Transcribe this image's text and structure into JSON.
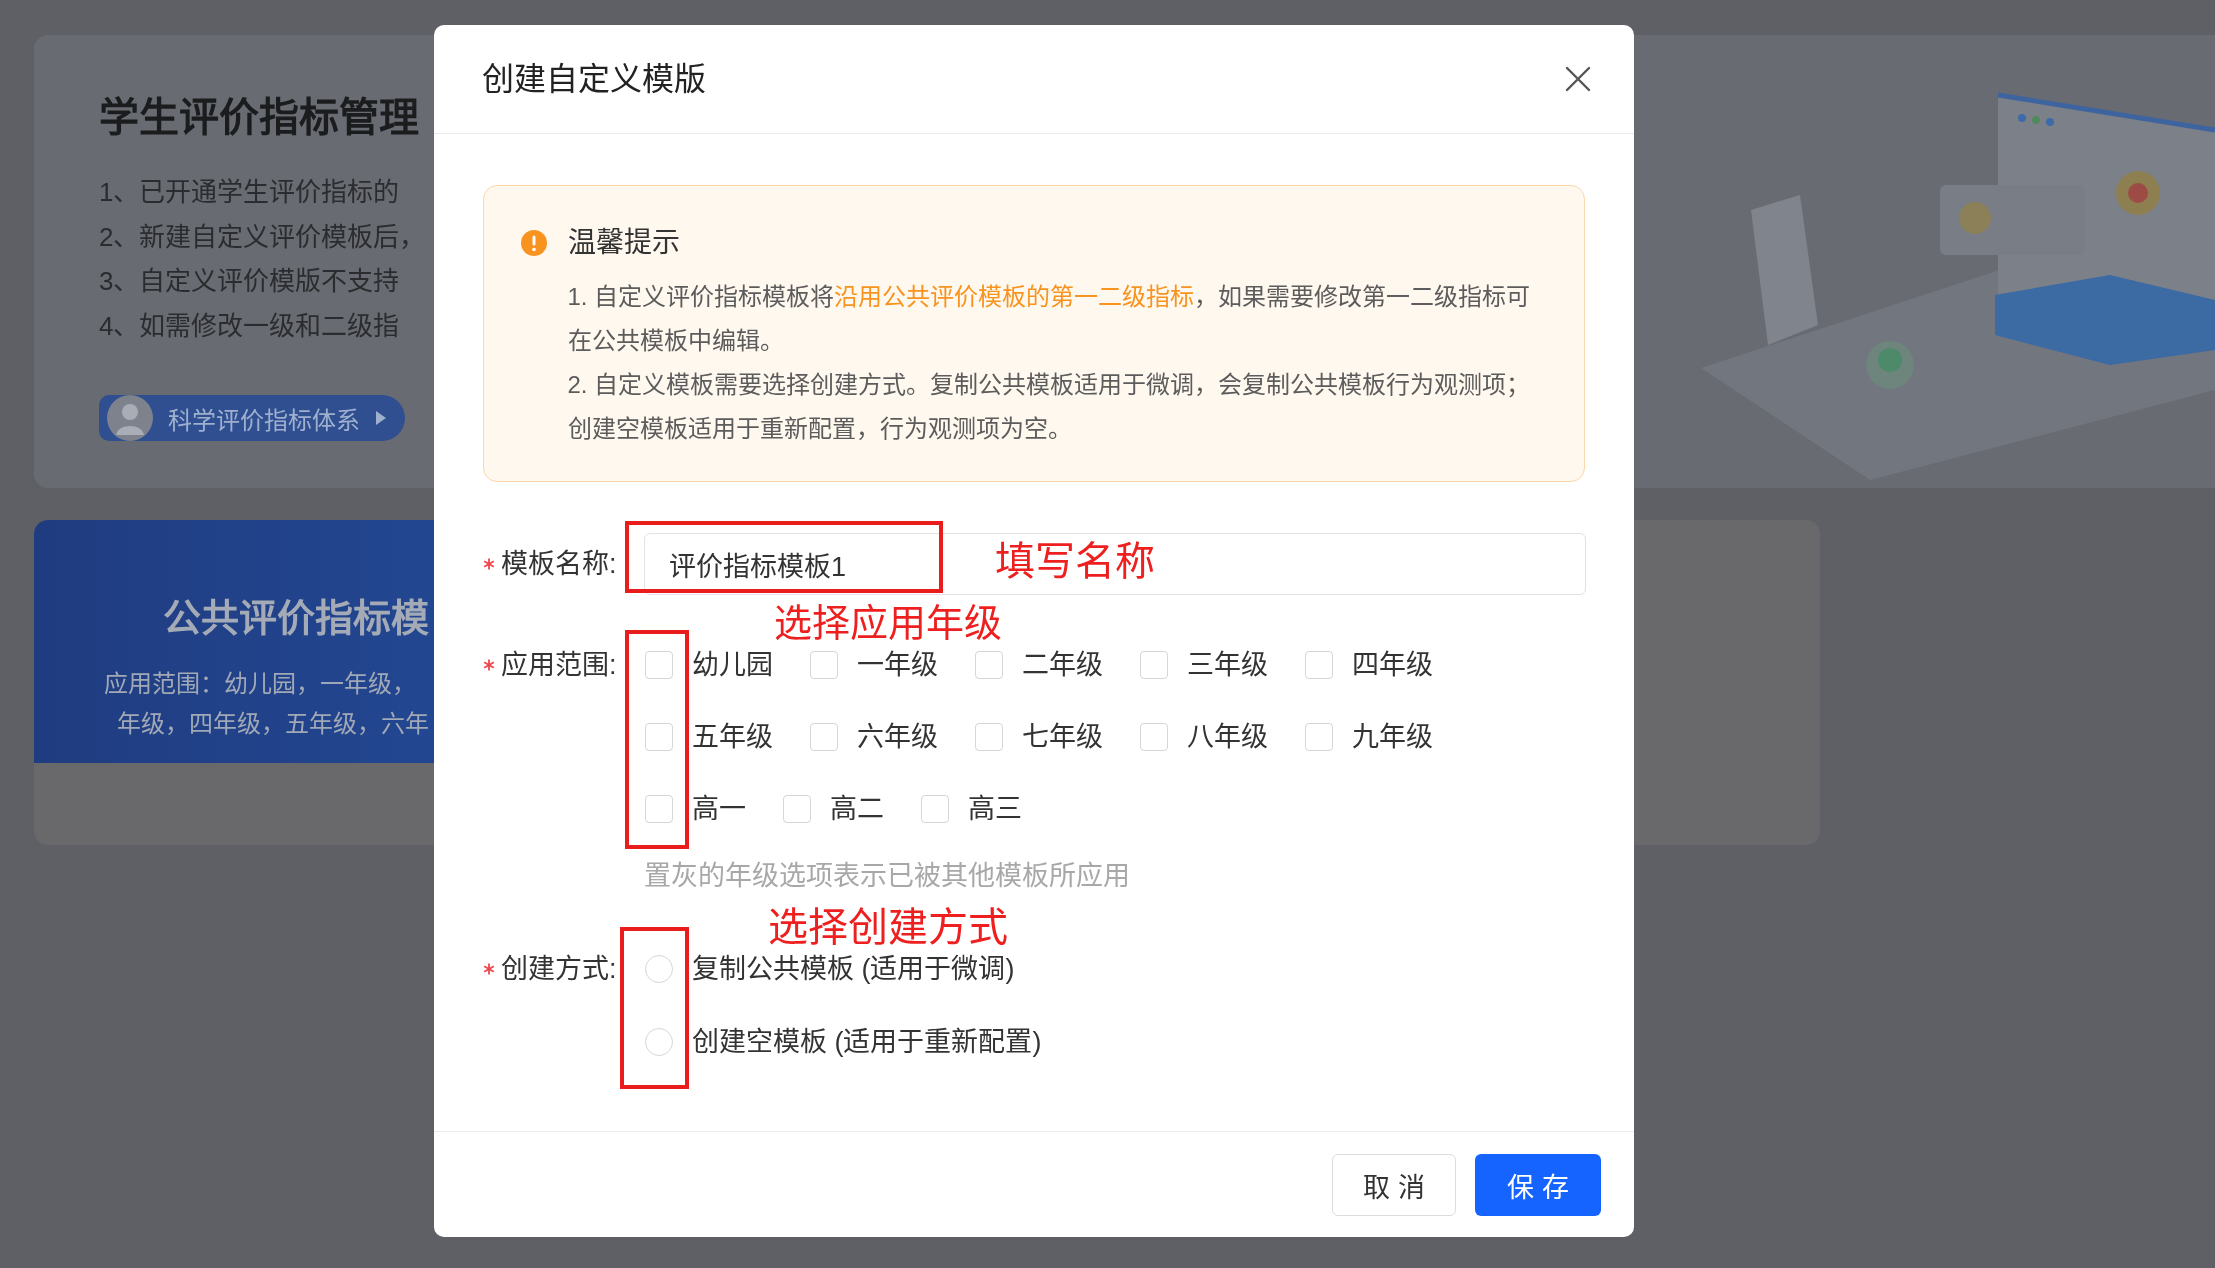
{
  "background": {
    "header_card": {
      "title": "学生评价指标管理",
      "notes": [
        "1、已开通学生评价指标的",
        "2、新建自定义评价模板后，",
        "3、自定义评价模版不支持",
        "4、如需修改一级和二级指"
      ],
      "link": {
        "label": "科学评价指标体系"
      }
    },
    "template_card": {
      "title": "公共评价指标模",
      "scope_lines": [
        "应用范围：幼儿园，一年级，",
        "年级，四年级，五年级，六年"
      ]
    }
  },
  "dialog": {
    "title": "创建自定义模版",
    "tip": {
      "title": "温馨提示",
      "items": [
        {
          "parts": [
            {
              "text": "1. 自定义评价指标模板将",
              "highlight": false
            },
            {
              "text": "沿用公共评价模板的第一二级指标",
              "highlight": true
            },
            {
              "text": "，如果需要修改第一二级指标可在公共模板中编辑。",
              "highlight": false
            }
          ]
        },
        {
          "parts": [
            {
              "text": "2. 自定义模板需要选择创建方式。复制公共模板适用于微调，会复制公共模板行为观测项；创建空模板适用于重新配置，行为观测项为空。",
              "highlight": false
            }
          ]
        }
      ]
    },
    "form": {
      "fields": [
        {
          "kind": "text",
          "label": "模板名称:",
          "required": true,
          "value": "评价指标模板1",
          "annotation": "填写名称"
        },
        {
          "kind": "checkbox_group",
          "label": "应用范围:",
          "required": true,
          "options": [
            {
              "label": "幼儿园",
              "checked": false
            },
            {
              "label": "一年级",
              "checked": false
            },
            {
              "label": "二年级",
              "checked": false
            },
            {
              "label": "三年级",
              "checked": false
            },
            {
              "label": "四年级",
              "checked": false
            },
            {
              "label": "五年级",
              "checked": false
            },
            {
              "label": "六年级",
              "checked": false
            },
            {
              "label": "七年级",
              "checked": false
            },
            {
              "label": "八年级",
              "checked": false
            },
            {
              "label": "九年级",
              "checked": false
            },
            {
              "label": "高一",
              "checked": false
            },
            {
              "label": "高二",
              "checked": false
            },
            {
              "label": "高三",
              "checked": false
            }
          ],
          "hint": "置灰的年级选项表示已被其他模板所应用",
          "annotation": "选择应用年级"
        },
        {
          "kind": "radio_group",
          "label": "创建方式:",
          "required": true,
          "options": [
            {
              "label": "复制公共模板 (适用于微调)",
              "selected": false
            },
            {
              "label": "创建空模板 (适用于重新配置)",
              "selected": false
            }
          ],
          "annotation": "选择创建方式"
        }
      ]
    },
    "buttons": [
      {
        "label": "取 消",
        "kind": "default"
      },
      {
        "label": "保 存",
        "kind": "primary"
      }
    ]
  }
}
